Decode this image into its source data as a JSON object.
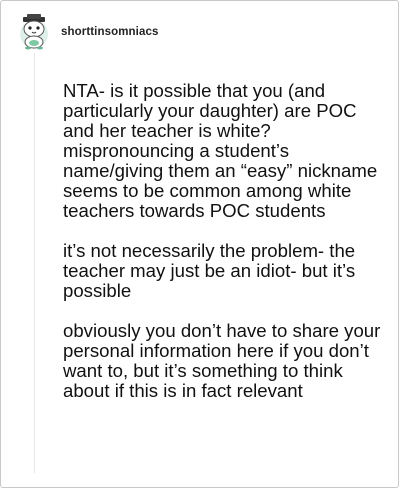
{
  "post": {
    "username": "shorttinsomniacs",
    "paragraphs": [
      "NTA- is it possible that you (and particularly your daughter) are POC and her teacher is white? mispronouncing a student’s name/giving them an “easy” nickname seems to be common among white teachers towards POC students",
      "it’s not necessarily the problem- the teacher may just be an idiot- but it’s possible",
      "obviously you don’t have to share your personal information here if you don’t want to, but it’s something to think about if this is in fact relevant"
    ]
  },
  "avatar": {
    "icon": "cartoon-character-avatar-icon"
  }
}
